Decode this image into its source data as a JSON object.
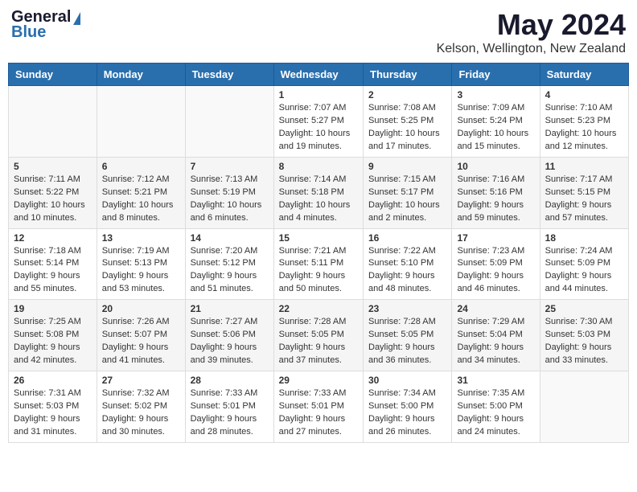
{
  "header": {
    "logo_general": "General",
    "logo_blue": "Blue",
    "main_title": "May 2024",
    "subtitle": "Kelson, Wellington, New Zealand"
  },
  "weekdays": [
    "Sunday",
    "Monday",
    "Tuesday",
    "Wednesday",
    "Thursday",
    "Friday",
    "Saturday"
  ],
  "weeks": [
    [
      {
        "day": "",
        "info": ""
      },
      {
        "day": "",
        "info": ""
      },
      {
        "day": "",
        "info": ""
      },
      {
        "day": "1",
        "info": "Sunrise: 7:07 AM\nSunset: 5:27 PM\nDaylight: 10 hours\nand 19 minutes."
      },
      {
        "day": "2",
        "info": "Sunrise: 7:08 AM\nSunset: 5:25 PM\nDaylight: 10 hours\nand 17 minutes."
      },
      {
        "day": "3",
        "info": "Sunrise: 7:09 AM\nSunset: 5:24 PM\nDaylight: 10 hours\nand 15 minutes."
      },
      {
        "day": "4",
        "info": "Sunrise: 7:10 AM\nSunset: 5:23 PM\nDaylight: 10 hours\nand 12 minutes."
      }
    ],
    [
      {
        "day": "5",
        "info": "Sunrise: 7:11 AM\nSunset: 5:22 PM\nDaylight: 10 hours\nand 10 minutes."
      },
      {
        "day": "6",
        "info": "Sunrise: 7:12 AM\nSunset: 5:21 PM\nDaylight: 10 hours\nand 8 minutes."
      },
      {
        "day": "7",
        "info": "Sunrise: 7:13 AM\nSunset: 5:19 PM\nDaylight: 10 hours\nand 6 minutes."
      },
      {
        "day": "8",
        "info": "Sunrise: 7:14 AM\nSunset: 5:18 PM\nDaylight: 10 hours\nand 4 minutes."
      },
      {
        "day": "9",
        "info": "Sunrise: 7:15 AM\nSunset: 5:17 PM\nDaylight: 10 hours\nand 2 minutes."
      },
      {
        "day": "10",
        "info": "Sunrise: 7:16 AM\nSunset: 5:16 PM\nDaylight: 9 hours\nand 59 minutes."
      },
      {
        "day": "11",
        "info": "Sunrise: 7:17 AM\nSunset: 5:15 PM\nDaylight: 9 hours\nand 57 minutes."
      }
    ],
    [
      {
        "day": "12",
        "info": "Sunrise: 7:18 AM\nSunset: 5:14 PM\nDaylight: 9 hours\nand 55 minutes."
      },
      {
        "day": "13",
        "info": "Sunrise: 7:19 AM\nSunset: 5:13 PM\nDaylight: 9 hours\nand 53 minutes."
      },
      {
        "day": "14",
        "info": "Sunrise: 7:20 AM\nSunset: 5:12 PM\nDaylight: 9 hours\nand 51 minutes."
      },
      {
        "day": "15",
        "info": "Sunrise: 7:21 AM\nSunset: 5:11 PM\nDaylight: 9 hours\nand 50 minutes."
      },
      {
        "day": "16",
        "info": "Sunrise: 7:22 AM\nSunset: 5:10 PM\nDaylight: 9 hours\nand 48 minutes."
      },
      {
        "day": "17",
        "info": "Sunrise: 7:23 AM\nSunset: 5:09 PM\nDaylight: 9 hours\nand 46 minutes."
      },
      {
        "day": "18",
        "info": "Sunrise: 7:24 AM\nSunset: 5:09 PM\nDaylight: 9 hours\nand 44 minutes."
      }
    ],
    [
      {
        "day": "19",
        "info": "Sunrise: 7:25 AM\nSunset: 5:08 PM\nDaylight: 9 hours\nand 42 minutes."
      },
      {
        "day": "20",
        "info": "Sunrise: 7:26 AM\nSunset: 5:07 PM\nDaylight: 9 hours\nand 41 minutes."
      },
      {
        "day": "21",
        "info": "Sunrise: 7:27 AM\nSunset: 5:06 PM\nDaylight: 9 hours\nand 39 minutes."
      },
      {
        "day": "22",
        "info": "Sunrise: 7:28 AM\nSunset: 5:05 PM\nDaylight: 9 hours\nand 37 minutes."
      },
      {
        "day": "23",
        "info": "Sunrise: 7:28 AM\nSunset: 5:05 PM\nDaylight: 9 hours\nand 36 minutes."
      },
      {
        "day": "24",
        "info": "Sunrise: 7:29 AM\nSunset: 5:04 PM\nDaylight: 9 hours\nand 34 minutes."
      },
      {
        "day": "25",
        "info": "Sunrise: 7:30 AM\nSunset: 5:03 PM\nDaylight: 9 hours\nand 33 minutes."
      }
    ],
    [
      {
        "day": "26",
        "info": "Sunrise: 7:31 AM\nSunset: 5:03 PM\nDaylight: 9 hours\nand 31 minutes."
      },
      {
        "day": "27",
        "info": "Sunrise: 7:32 AM\nSunset: 5:02 PM\nDaylight: 9 hours\nand 30 minutes."
      },
      {
        "day": "28",
        "info": "Sunrise: 7:33 AM\nSunset: 5:01 PM\nDaylight: 9 hours\nand 28 minutes."
      },
      {
        "day": "29",
        "info": "Sunrise: 7:33 AM\nSunset: 5:01 PM\nDaylight: 9 hours\nand 27 minutes."
      },
      {
        "day": "30",
        "info": "Sunrise: 7:34 AM\nSunset: 5:00 PM\nDaylight: 9 hours\nand 26 minutes."
      },
      {
        "day": "31",
        "info": "Sunrise: 7:35 AM\nSunset: 5:00 PM\nDaylight: 9 hours\nand 24 minutes."
      },
      {
        "day": "",
        "info": ""
      }
    ]
  ]
}
